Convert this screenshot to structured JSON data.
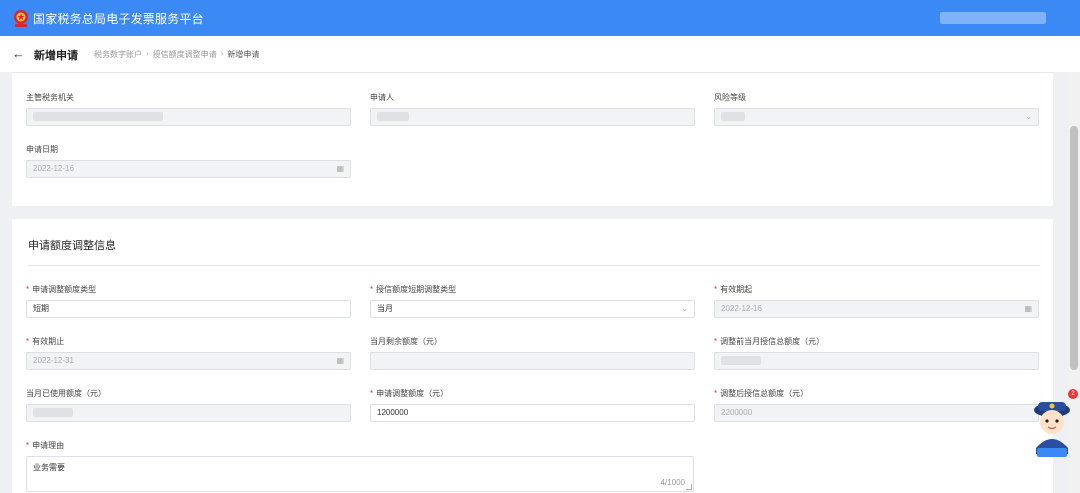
{
  "header": {
    "title": "国家税务总局电子发票服务平台",
    "brand_color": "#3b89f5"
  },
  "subheader": {
    "back_icon": "arrow-left-icon",
    "page_title": "新增申请",
    "breadcrumb": [
      "税务数字账户",
      "授信额度调整申请",
      "新增申请"
    ]
  },
  "basic_info": {
    "tax_authority": {
      "label": "主管税务机关"
    },
    "applicant": {
      "label": "申请人"
    },
    "risk_level": {
      "label": "风险等级"
    },
    "apply_date": {
      "label": "申请日期",
      "value": "2022-12-16"
    }
  },
  "adjustment": {
    "section_title": "申请额度调整信息",
    "adjust_type": {
      "label": "申请调整额度类型",
      "value": "短期"
    },
    "short_term_type": {
      "label": "授信额度短期调整类型",
      "value": "当月"
    },
    "valid_from": {
      "label": "有效期起",
      "value": "2022-12-16"
    },
    "valid_to": {
      "label": "有效期止",
      "value": "2022-12-31"
    },
    "month_remaining": {
      "label": "当月剩余额度（元）"
    },
    "before_total": {
      "label": "调整前当月授信总额度（元）"
    },
    "month_used": {
      "label": "当月已使用额度（元）"
    },
    "apply_amount": {
      "label": "申请调整额度（元）",
      "value": "1200000"
    },
    "after_total": {
      "label": "调整后授信总额度（元）",
      "value": "2200000"
    },
    "reason": {
      "label": "申请理由",
      "value": "业务需要",
      "counter": "4/1000"
    }
  },
  "assistant": {
    "badge": "2"
  }
}
